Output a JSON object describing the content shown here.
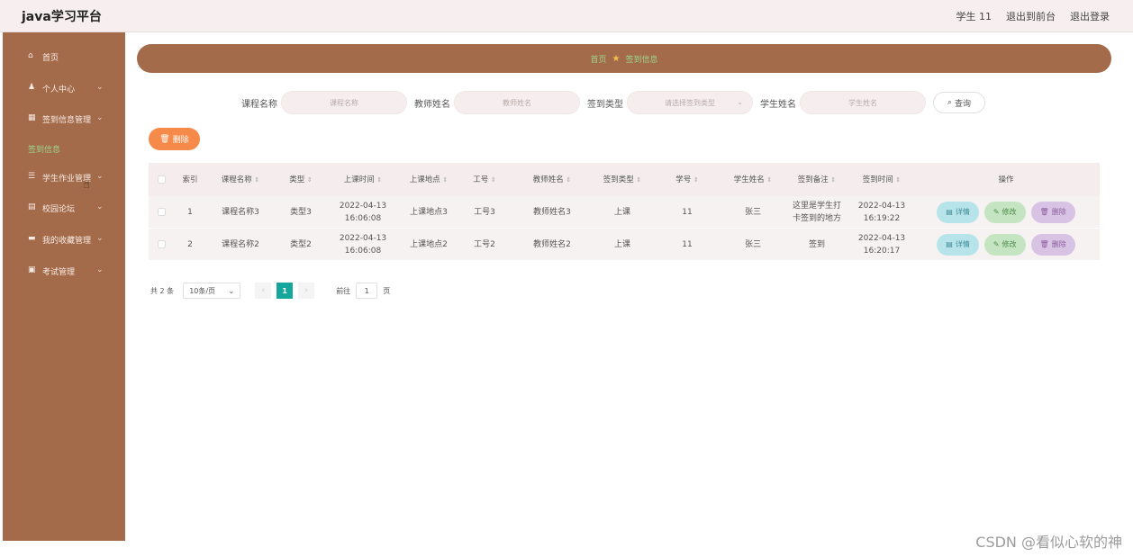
{
  "header": {
    "app_title": "java学习平台",
    "user": "学生 11",
    "back_front": "退出到前台",
    "logout": "退出登录"
  },
  "sidebar": {
    "items": [
      {
        "label": "首页",
        "icon": "home-icon"
      },
      {
        "label": "个人中心",
        "icon": "user-icon"
      },
      {
        "label": "签到信息管理",
        "icon": "grid-icon"
      },
      {
        "label": "签到信息",
        "icon": ""
      },
      {
        "label": "学生作业管理",
        "icon": "list-icon"
      },
      {
        "label": "校园论坛",
        "icon": "doc-icon"
      },
      {
        "label": "我的收藏管理",
        "icon": "bookmark-icon"
      },
      {
        "label": "考试管理",
        "icon": "exam-icon"
      }
    ]
  },
  "breadcrumb": {
    "home": "首页",
    "current": "签到信息"
  },
  "search": {
    "course_label": "课程名称",
    "course_placeholder": "课程名称",
    "teacher_label": "教师姓名",
    "teacher_placeholder": "教师姓名",
    "signtype_label": "签到类型",
    "signtype_placeholder": "请选择签到类型",
    "student_label": "学生姓名",
    "student_placeholder": "学生姓名",
    "query_label": "查询"
  },
  "toolbar": {
    "delete_label": "删除"
  },
  "table": {
    "headers": [
      "索引",
      "课程名称",
      "类型",
      "上课时间",
      "上课地点",
      "工号",
      "教师姓名",
      "签到类型",
      "学号",
      "学生姓名",
      "签到备注",
      "签到时间",
      "操作"
    ],
    "rows": [
      {
        "idx": "1",
        "course": "课程名称3",
        "type": "类型3",
        "time_date": "2022-04-13",
        "time_clock": "16:06:08",
        "place": "上课地点3",
        "no": "工号3",
        "teacher": "教师姓名3",
        "signtype": "上课",
        "stuno": "11",
        "stuname": "张三",
        "remark_a": "这里是学生打",
        "remark_b": "卡签到的地方",
        "sign_date": "2022-04-13",
        "sign_clock": "16:19:22"
      },
      {
        "idx": "2",
        "course": "课程名称2",
        "type": "类型2",
        "time_date": "2022-04-13",
        "time_clock": "16:06:08",
        "place": "上课地点2",
        "no": "工号2",
        "teacher": "教师姓名2",
        "signtype": "上课",
        "stuno": "11",
        "stuname": "张三",
        "remark_a": "签到",
        "remark_b": "",
        "sign_date": "2022-04-13",
        "sign_clock": "16:20:17"
      }
    ],
    "ops": {
      "detail": "详情",
      "edit": "修改",
      "delete": "删除"
    }
  },
  "pagination": {
    "total": "共 2 条",
    "page_size": "10条/页",
    "current_page": "1",
    "goto_label": "前往",
    "goto_value": "1",
    "page_unit": "页"
  },
  "watermark": "CSDN @看似心软的神",
  "colors": {
    "sidebar_bg": "#a46b4b",
    "accent_green": "#9bd48a",
    "delete_orange": "#f68a4a",
    "pager_active": "#17a69c"
  }
}
